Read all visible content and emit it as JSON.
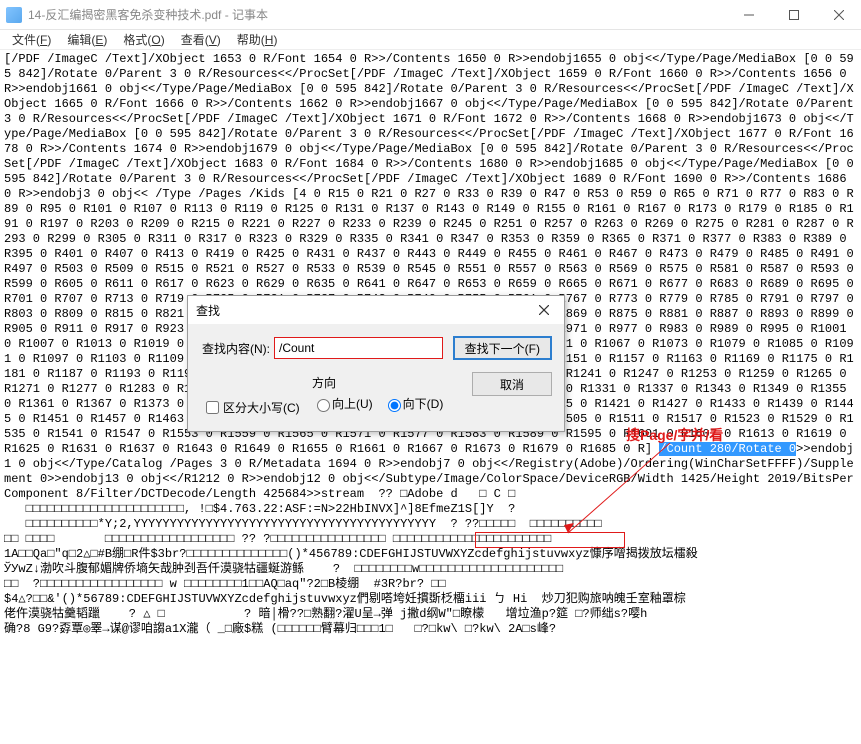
{
  "window": {
    "title": "14-反汇编揭密黑客免杀变种技术.pdf - 记事本"
  },
  "menu": {
    "file": {
      "label": "文件",
      "key": "F"
    },
    "edit": {
      "label": "编辑",
      "key": "E"
    },
    "format": {
      "label": "格式",
      "key": "O"
    },
    "view": {
      "label": "查看",
      "key": "V"
    },
    "help": {
      "label": "帮助",
      "key": "H"
    }
  },
  "find": {
    "title": "查找",
    "label": "查找内容(N):",
    "value": "/Count",
    "next": "查找下一个(F)",
    "cancel": "取消",
    "matchcase": "区分大小写(C)",
    "dir_label": "方向",
    "dir_up": "向上(U)",
    "dir_down": "向下(D)"
  },
  "annotation": {
    "text": "搜Page/字并/看"
  },
  "highlight": {
    "text": "/Count 280/Rotate 0"
  },
  "body_pre": "[/PDF /ImageC /Text]/XObject 1653 0 R/Font 1654 0 R>>/Contents 1650 0 R>>endobj1655 0 obj<</Type/Page/MediaBox [0 0 595 842]/Rotate 0/Parent 3 0 R/Resources<</ProcSet[/PDF /ImageC /Text]/XObject 1659 0 R/Font 1660 0 R>>/Contents 1656 0 R>>endobj1661 0 obj<</Type/Page/MediaBox [0 0 595 842]/Rotate 0/Parent 3 0 R/Resources<</ProcSet[/PDF /ImageC /Text]/XObject 1665 0 R/Font 1666 0 R>>/Contents 1662 0 R>>endobj1667 0 obj<</Type/Page/MediaBox [0 0 595 842]/Rotate 0/Parent 3 0 R/Resources<</ProcSet[/PDF /ImageC /Text]/XObject 1671 0 R/Font 1672 0 R>>/Contents 1668 0 R>>endobj1673 0 obj<</Type/Page/MediaBox [0 0 595 842]/Rotate 0/Parent 3 0 R/Resources<</ProcSet[/PDF /ImageC /Text]/XObject 1677 0 R/Font 1678 0 R>>/Contents 1674 0 R>>endobj1679 0 obj<</Type/Page/MediaBox [0 0 595 842]/Rotate 0/Parent 3 0 R/Resources<</ProcSet[/PDF /ImageC /Text]/XObject 1683 0 R/Font 1684 0 R>>/Contents 1680 0 R>>endobj1685 0 obj<</Type/Page/MediaBox [0 0 595 842]/Rotate 0/Parent 3 0 R/Resources<</ProcSet[/PDF /ImageC /Text]/XObject 1689 0 R/Font 1690 0 R>>/Contents 1686 0 R>>endobj3 0 obj<< /Type /Pages /Kids [4 0 R15 0 R21 0 R27 0 R33 0 R39 0 R47 0 R53 0 R59 0 R65 0 R71 0 R77 0 R83 0 R89 0 R95 0 R101 0 R107 0 R113 0 R119 0 R125 0 R131 0 R137 0 R143 0 R149 0 R155 0 R161 0 R167 0 R173 0 R179 0 R185 0 R191 0 R197 0 R203 0 R209 0 R215 0 R221 0 R227 0 R233 0 R239 0 R245 0 R251 0 R257 0 R263 0 R269 0 R275 0 R281 0 R287 0 R293 0 R299 0 R305 0 R311 0 R317 0 R323 0 R329 0 R335 0 R341 0 R347 0 R353 0 R359 0 R365 0 R371 0 R377 0 R383 0 R389 0 R395 0 R401 0 R407 0 R413 0 R419 0 R425 0 R431 0 R437 0 R443 0 R449 0 R455 0 R461 0 R467 0 R473 0 R479 0 R485 0 R491 0 R497 0 R503 0 R509 0 R515 0 R521 0 R527 0 R533 0 R539 0 R545 0 R551 0 R557 0 R563 0 R569 0 R575 0 R581 0 R587 0 R593 0 R599 0 R605 0 R611 0 R617 0 R623 0 R629 0 R635 0 R641 0 R647 0 R653 0 R659 0 R665 0 R671 0 R677 0 R683 0 R689 0 R695 0 R701 0 R707 0 R713 0 R719 0 R725 0 R731 0 R737 0 R743 0 R749 0 R755 0 R761 0 R767 0 R773 0 R779 0 R785 0 R791 0 R797 0 R803 0 R809 0 R815 0 R821 0 R827 0 R833 0 R839 0 R845 0 R851 0 R857 0 R863 0 R869 0 R875 0 R881 0 R887 0 R893 0 R899 0 R905 0 R911 0 R917 0 R923 0 R929 0 R935 0 R941 0 R947 0 R953 0 R959 0 R965 0 R971 0 R977 0 R983 0 R989 0 R995 0 R1001 0 R1007 0 R1013 0 R1019 0 R1025 0 R1031 0 R1037 0 R1043 0 R1049 0 R1055 0 R1061 0 R1067 0 R1073 0 R1079 0 R1085 0 R1091 0 R1097 0 R1103 0 R1109 0 R1115 0 R1121 0 R1127 0 R1133 0 R1139 0 R1145 0 R1151 0 R1157 0 R1163 0 R1169 0 R1175 0 R1181 0 R1187 0 R1193 0 R1199 0 R1205 0 R1211 0 R1217 0 R1223 0 R1229 0 R1235 0 R1241 0 R1247 0 R1253 0 R1259 0 R1265 0 R1271 0 R1277 0 R1283 0 R1289 0 R1295 0 R1301 0 R1307 0 R1313 0 R1319 0 R1325 0 R1331 0 R1337 0 R1343 0 R1349 0 R1355 0 R1361 0 R1367 0 R1373 0 R1379 0 R1385 0 R1391 0 R1397 0 R1403 0 R1409 0 R1415 0 R1421 0 R1427 0 R1433 0 R1439 0 R1445 0 R1451 0 R1457 0 R1463 0 R1469 0 R1475 0 R1481 0 R1487 0 R1493 0 R1499 0 R1505 0 R1511 0 R1517 0 R1523 0 R1529 0 R1535 0 R1541 0 R1547 0 R1553 0 R1559 0 R1565 0 R1571 0 R1577 0 R1583 0 R1589 0 R1595 0 R1601 0 R1607 0 R1613 0 R1619 0 R1625 0 R1631 0 R1637 0 R1643 0 R1649 0 R1655 0 R1661 0 R1667 0 R1673 0 R1679 0 R1685 0 R] ",
  "body_post": ">>endobj1 0 obj<</Type/Catalog /Pages 3 0 R/Metadata 1694 0 R>>endobj7 0 obj<</Registry(Adobe)/Ordering(WinCharSetFFFF)/Supplement 0>>endobj13 0 obj<</R1212 0 R>>endobj12 0 obj<</Subtype/Image/ColorSpace/DeviceRGB/Width 1425/Height 2019/BitsPerComponent 8/Filter/DCTDecode/Length 425684>>stream  ?? □Adobe d   □ C □\n   □□□□□□□□□□□□□□□□□□□□□□, !□$4.763.22:ASF:=N>22HbINVX]^]8EfmeZ1S[]Y  ?\n   □□□□□□□□□□*Y;2,YYYYYYYYYYYYYYYYYYYYYYYYYYYYYYYYYYYYYYYYYY  ? ??□□□□□  □□□□□□□□□□\n□□ □□□□       □□□□□□□□□□□□□□□□□□ ?? ?□□□□□□□□□□□□□□□□ □□□□□□□□□□□□□□□□□□□□□□\n1A□□Qa□\"q□2△□#B绷□R件$3br?□□□□□□□□□□□□□□()*456789:CDEFGHIJSTUVWXYZcdefghijstuvwxyz慷序噌揭拨放坛檑殺\nЎУwZ↓渤吹斗腹郁媚牌侨墒矢哉肿刭吾仟漠骁牯疆蜒游鲧    ?  □□□□□□□□w□□□□□□□□□□□□□□□□□□□□\n□□  ?□□□□□□□□□□□□□□□□□ w □□□□□□□□1□□AQ□aq\"?2□B棱绷  #3R?br? □□\n$4△?□□&'()*56789:CDEFGHIJSTUVWXYZcdefghijstuvwxyz們剔嗒垮妊摜斲柉橊iii ㄅ Hi  炒刀犯购旅呐魄壬室釉罩棕\n佬仵漠骁牯羹韬躐    ? △ □           ? 暗│榾??□熟翻?濯U呈→弹 j撇d纲W\"□瞭檬   增垃渔p?筵 □?师绌s?嘤h\n确?8 G9?孬覃◎睪→谋@谬咱謅a1X瀧（ _□廠$糕 (□□□□□□臂幕归□□□1□   □?□kw\\ □?kw\\ 2A□s峰?"
}
